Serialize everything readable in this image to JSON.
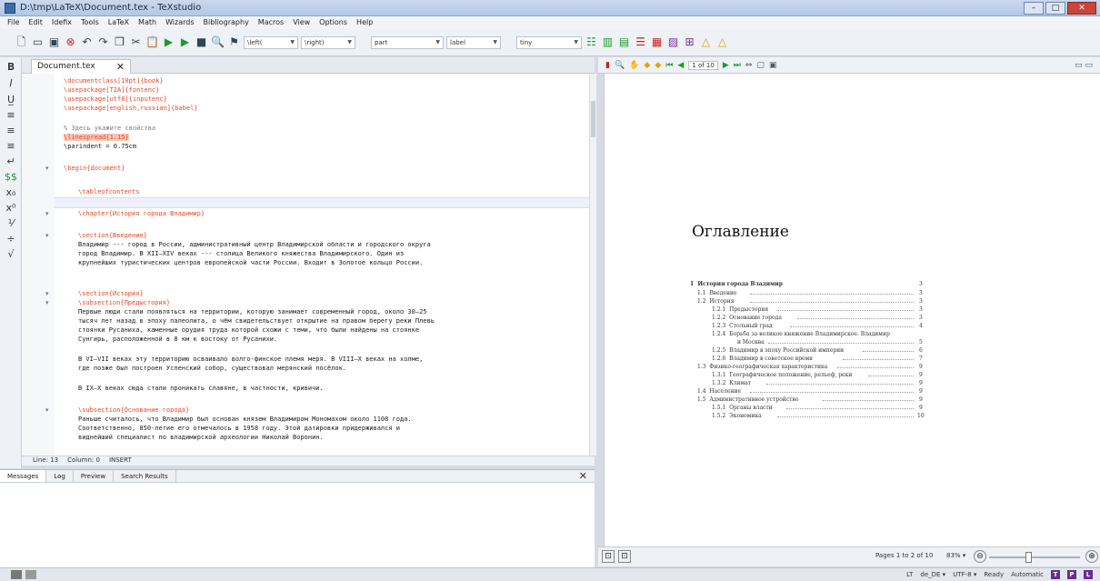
{
  "window": {
    "title": "D:\\tmp\\LaTeX\\Document.tex - TeXstudio",
    "minimize": "–",
    "maximize": "□",
    "close": "✕"
  },
  "menu": [
    "File",
    "Edit",
    "Idefix",
    "Tools",
    "LaTeX",
    "Math",
    "Wizards",
    "Bibliography",
    "Macros",
    "View",
    "Options",
    "Help"
  ],
  "toolbar": {
    "left_select": "\\left(",
    "right_select": "\\right)",
    "part_select": "part",
    "label_select": "label",
    "size_select": "tiny"
  },
  "editor": {
    "tab_label": "Document.tex",
    "lines": [
      {
        "t": "\\documentclass[10pt]{book}"
      },
      {
        "t": "\\usepackage[T2A]{fontenc}"
      },
      {
        "t": "\\usepackage[utf8]{inputenc}"
      },
      {
        "t": "\\usepackage[english,russian]{babel}"
      },
      {
        "t": ""
      },
      {
        "t": "% Здесь укажите свойства"
      },
      {
        "t": "\\linespread{1.15}"
      },
      {
        "t": "\\parindent = 0.75cm"
      },
      {
        "t": ""
      },
      {
        "t": "\\begin{document}"
      },
      {
        "t": ""
      },
      {
        "t": "\\tableofcontents"
      },
      {
        "t": ""
      },
      {
        "t": "\\chapter{История города Владимир}"
      },
      {
        "t": ""
      },
      {
        "t": "\\section{Введение}"
      },
      {
        "t": "Владимир --- город в России, административный центр Владимирской области и городского округа"
      },
      {
        "t": "город Владимир. В XII–XIV веках --- столица Великого княжества Владимирского. Один из"
      },
      {
        "t": "крупнейших туристических центров европейской части России. Входит в Золотое кольцо России."
      },
      {
        "t": ""
      },
      {
        "t": ""
      },
      {
        "t": "\\section{История}"
      },
      {
        "t": "\\subsection{Предыстория}"
      },
      {
        "t": "Первые люди стали появляться на территории, которую занимает современный город, около 30–25"
      },
      {
        "t": "тысяч лет назад в эпоху палеолита, о чём свидетельствует открытие на правом берегу реки Плевь"
      },
      {
        "t": "стоянки Русаниха, каменные орудия труда которой схожи с теми, что были найдены на стоянке"
      },
      {
        "t": "Сунгирь, расположенной в 8 км к востоку от Русанихи."
      },
      {
        "t": ""
      },
      {
        "t": "В VI–VII веках эту территорию осваивало волго-финское племя меря. В VIII–X веках на холме,"
      },
      {
        "t": "где позже был построен Успенский собор, существовал мерянский посёлок."
      },
      {
        "t": ""
      },
      {
        "t": "В IX–X веках сюда стали проникать славяне, в частности, кривичи."
      },
      {
        "t": ""
      },
      {
        "t": "\\subsection{Основание города}"
      },
      {
        "t": "Раньше считалось, что Владимир был основан князем Владимиром Мономахом около 1108 года."
      },
      {
        "t": "Соответственно, 850-летие его отмечалось в 1958 году. Этой датировки придерживался и"
      },
      {
        "t": "виднейший специалист по владимирской археологии Николай Воронин."
      }
    ],
    "status": {
      "line": "Line: 13",
      "column": "Column: 0",
      "mode": "INSERT"
    }
  },
  "messages": {
    "tabs": [
      "Messages",
      "Log",
      "Preview",
      "Search Results"
    ],
    "close": "✕"
  },
  "pdf": {
    "page_box": "1 of 10",
    "toc_title": "Оглавление",
    "toc": [
      {
        "num": "1",
        "text": "История города Владимир",
        "page": "3",
        "level": 0
      },
      {
        "num": "1.1",
        "text": "Введение",
        "page": "3",
        "level": 1
      },
      {
        "num": "1.2",
        "text": "История",
        "page": "3",
        "level": 1
      },
      {
        "num": "1.2.1",
        "text": "Предыстория",
        "page": "3",
        "level": 2
      },
      {
        "num": "1.2.2",
        "text": "Основание города",
        "page": "3",
        "level": 2
      },
      {
        "num": "1.2.3",
        "text": "Стольный град",
        "page": "4",
        "level": 2
      },
      {
        "num": "1.2.4",
        "text": "Борьба за великое княжение Владимирское. Владимир",
        "page": "",
        "level": 2
      },
      {
        "num": "",
        "text": "и Москва",
        "page": "5",
        "level": 2
      },
      {
        "num": "1.2.5",
        "text": "Владимир в эпоху Российской империи",
        "page": "6",
        "level": 2
      },
      {
        "num": "1.2.6",
        "text": "Владимир в советское время",
        "page": "7",
        "level": 2
      },
      {
        "num": "1.3",
        "text": "Физико-географическая характеристика",
        "page": "9",
        "level": 1
      },
      {
        "num": "1.3.1",
        "text": "Географическое положение, рельеф, реки",
        "page": "9",
        "level": 2
      },
      {
        "num": "1.3.2",
        "text": "Климат",
        "page": "9",
        "level": 2
      },
      {
        "num": "1.4",
        "text": "Население",
        "page": "9",
        "level": 1
      },
      {
        "num": "1.5",
        "text": "Административное устройство",
        "page": "9",
        "level": 1
      },
      {
        "num": "1.5.1",
        "text": "Органы власти",
        "page": "9",
        "level": 2
      },
      {
        "num": "1.5.2",
        "text": "Экономика",
        "page": "10",
        "level": 2
      }
    ],
    "pages_status": "Pages 1 to 2 of 10",
    "zoom": "83%"
  },
  "statusbar": {
    "lang": "LT",
    "dict": "de_DE",
    "encoding": "UTF-8",
    "ready": "Ready",
    "automatic": "Automatic"
  }
}
